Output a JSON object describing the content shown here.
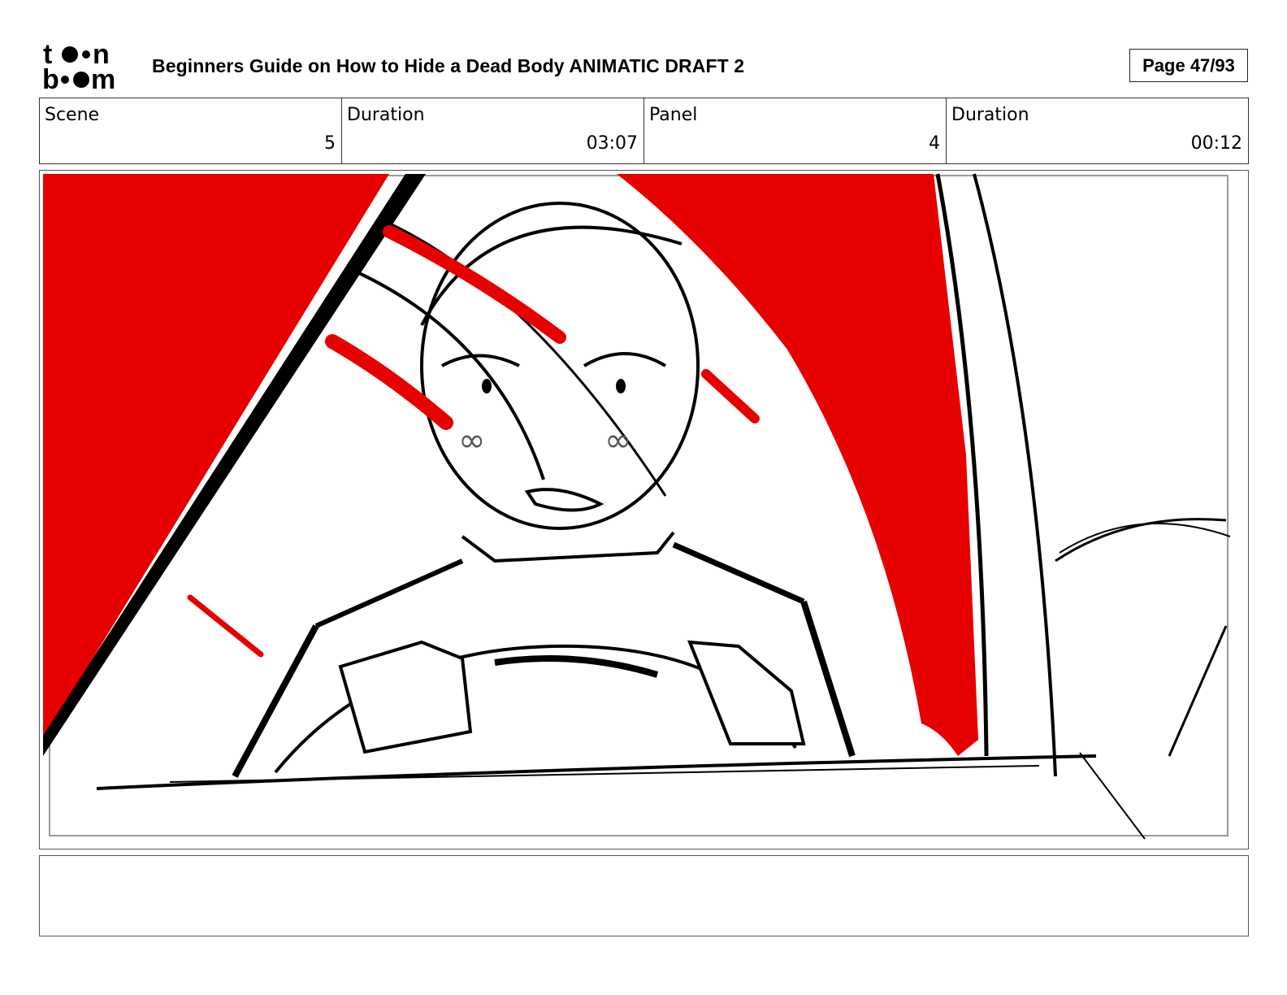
{
  "header": {
    "logo_text": "toonboom",
    "title": "Beginners Guide on How to Hide a Dead Body ANIMATIC DRAFT 2",
    "page_label": "Page 47/93"
  },
  "info": {
    "scene_label": "Scene",
    "scene_value": "5",
    "scene_duration_label": "Duration",
    "scene_duration_value": "03:07",
    "panel_label": "Panel",
    "panel_value": "4",
    "panel_duration_label": "Duration",
    "panel_duration_value": "00:12"
  },
  "panel": {
    "image_icon": "storyboard-sketch",
    "accent_color": "#e60000"
  },
  "notes": {
    "text": ""
  }
}
